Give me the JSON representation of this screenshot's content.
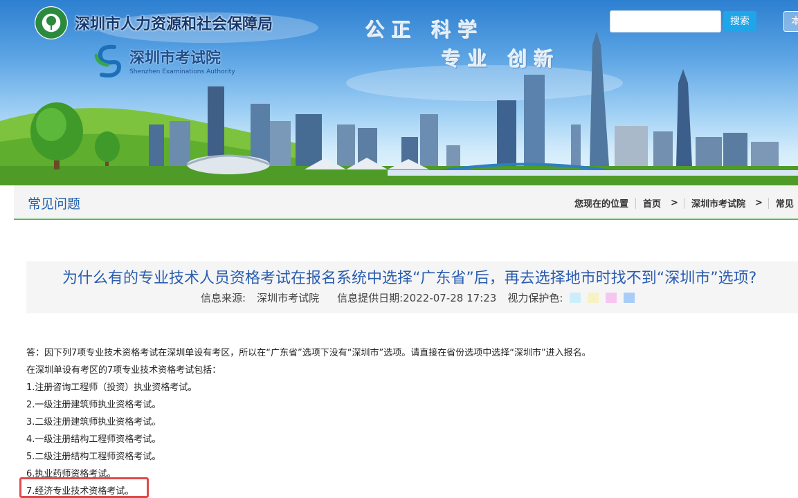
{
  "header": {
    "org_title": "深圳市人力资源和社会保障局",
    "exam_name_cn": "深圳市考试院",
    "exam_name_en": "Shenzhen Examinations Authority",
    "slogan_line1": "公正 科学",
    "slogan_line2": "专业 创新",
    "search": {
      "value": "",
      "button_label": "搜索"
    },
    "extra_button_label": "本"
  },
  "breadcrumb": {
    "section_title": "常见问题",
    "location_label": "您现在的位置",
    "items": [
      "首页",
      "深圳市考试院",
      "常见"
    ]
  },
  "article": {
    "title": "为什么有的专业技术人员资格考试在报名系统中选择“广东省”后，再去选择地市时找不到“深圳市”选项?",
    "source_label": "信息来源:",
    "source_value": "深圳市考试院",
    "date_label": "信息提供日期:",
    "date_value": "2022-07-28 17:23",
    "eye_care_label": "视力保护色:",
    "eye_care_colors": [
      "#cceefb",
      "#f6f2c4",
      "#f6c6f1",
      "#a9cdf6"
    ],
    "paragraphs": [
      "答：因下列7项专业技术资格考试在深圳单设有考区，所以在“广东省”选项下没有“深圳市”选项。请直接在省份选项中选择“深圳市”进入报名。",
      "在深圳单设有考区的7项专业技术资格考试包括：",
      "1.注册咨询工程师（投资）执业资格考试。",
      "2.一级注册建筑师执业资格考试。",
      "3.二级注册建筑师执业资格考试。",
      "4.一级注册结构工程师资格考试。",
      "5.二级注册结构工程师资格考试。",
      "6.执业药师资格考试。",
      "7.经济专业技术资格考试。"
    ]
  },
  "colors": {
    "accent_blue": "#1f5fa8",
    "search_button": "#20a5e8",
    "breadcrumb_underline": "#5bb85b",
    "highlight_border": "#e04a4a"
  }
}
